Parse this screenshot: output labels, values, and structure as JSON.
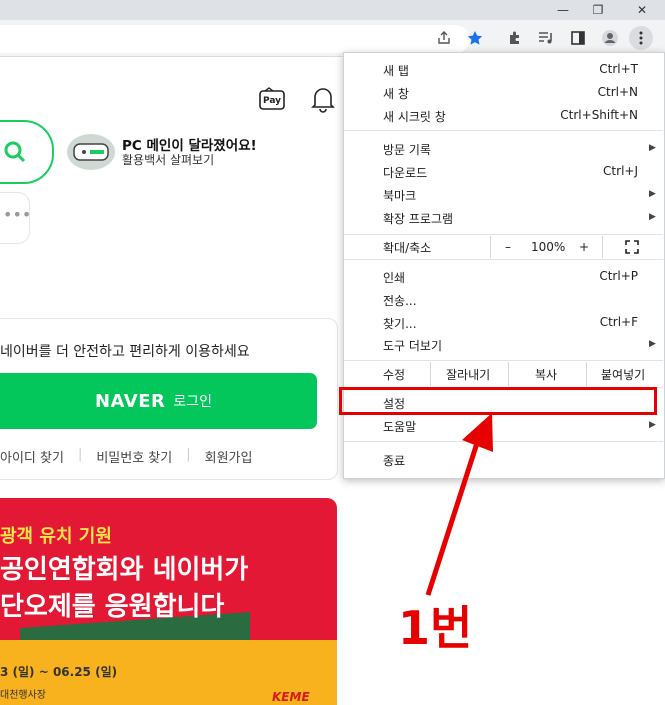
{
  "menu": {
    "new_tab": {
      "label": "새 탭",
      "shortcut": "Ctrl+T"
    },
    "new_window": {
      "label": "새 창",
      "shortcut": "Ctrl+N"
    },
    "new_incognito": {
      "label": "새 시크릿 창",
      "shortcut": "Ctrl+Shift+N"
    },
    "history": {
      "label": "방문 기록"
    },
    "downloads": {
      "label": "다운로드",
      "shortcut": "Ctrl+J"
    },
    "bookmarks": {
      "label": "북마크"
    },
    "extensions": {
      "label": "확장 프로그램"
    },
    "zoom": {
      "label": "확대/축소",
      "minus": "–",
      "value": "100%",
      "plus": "+"
    },
    "print": {
      "label": "인쇄",
      "shortcut": "Ctrl+P"
    },
    "cast": {
      "label": "전송..."
    },
    "find": {
      "label": "찾기...",
      "shortcut": "Ctrl+F"
    },
    "more_tools": {
      "label": "도구 더보기"
    },
    "edit": {
      "label": "수정",
      "cut": "잘라내기",
      "copy": "복사",
      "paste": "붙여넣기"
    },
    "settings": {
      "label": "설정"
    },
    "help": {
      "label": "도움말"
    },
    "exit": {
      "label": "종료"
    }
  },
  "page": {
    "promo_title": "PC 메인이 달라졌어요!",
    "promo_sub": "활용백서 살펴보기",
    "login_msg": "네이버를 더 안전하고 편리하게 이용하세요",
    "naver_logo": "NAVER",
    "login_label": "로그인",
    "links": [
      "아이디 찾기",
      "비밀번호 찾기",
      "회원가입"
    ],
    "banner": {
      "line1": "광객 유치 기원",
      "line2": "공인연합회와 네이버가",
      "line3": "단오제를 응원합니다",
      "date": "3 (일) ~ 06.25 (일)",
      "place": "대천행사장",
      "logo": "KEME"
    },
    "pay_label": "Pay"
  },
  "annotation": "1번",
  "colors": {
    "naver_green": "#03c75a",
    "annotation_red": "#e60000",
    "banner_red": "#e21835"
  }
}
